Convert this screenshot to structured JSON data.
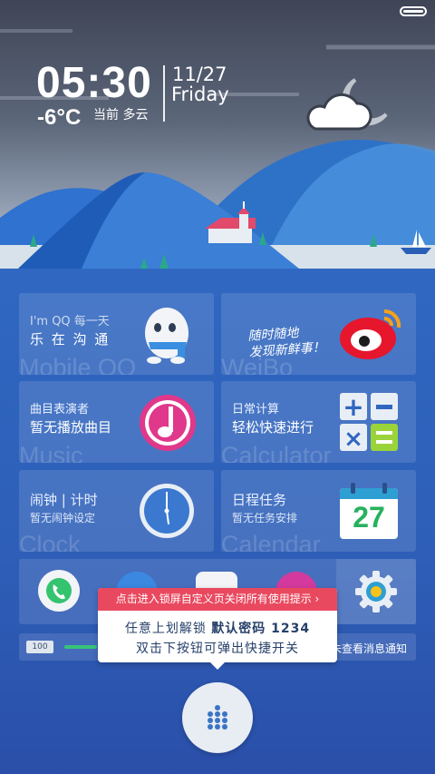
{
  "status": {
    "battery_icon": "battery-icon"
  },
  "clock": {
    "time": "05:30",
    "date": "11/27",
    "day": "Friday"
  },
  "weather": {
    "temp": "-6°C",
    "condition": "当前 多云",
    "icon": "cloud-moon-icon"
  },
  "tiles": [
    {
      "line1": "I'm QQ 每一天",
      "line2": "乐 在 沟 通",
      "ghost": "Mobile QQ",
      "icon": "qq-penguin-icon"
    },
    {
      "line1": "随时随地",
      "line2": "发现新鲜事！",
      "ghost": "WeiBo",
      "icon": "weibo-icon"
    },
    {
      "line1": "曲目表演者",
      "line2": "暂无播放曲目",
      "ghost": "Music",
      "icon": "music-note-icon"
    },
    {
      "line1": "日常计算",
      "line2": "轻松快速进行",
      "ghost": "Calculator",
      "icon": "calculator-icon"
    },
    {
      "line1": "闹钟 | 计时",
      "line2": "暂无闹钟设定",
      "ghost": "Clock",
      "icon": "clock-icon"
    },
    {
      "line1": "日程任务",
      "line2": "暂无任务安排",
      "ghost": "Calendar",
      "icon": "calendar-icon",
      "calendar_day": "27"
    }
  ],
  "dock": {
    "icons": [
      "phone-icon",
      "browser-icon",
      "camera-icon",
      "gallery-icon",
      "settings-gear-icon"
    ]
  },
  "tooltip": {
    "header": "点击进入锁屏自定义页关闭所有使用提示 ›",
    "line1_a": "任意上划解锁 ",
    "line1_b": "默认密码 1234",
    "line2": "双击下按钮可弹出快捷开关"
  },
  "message_bar": {
    "badge": "100",
    "text": "未查看消息通知"
  },
  "home_button": {
    "icon": "dots-grid-icon"
  },
  "colors": {
    "accent_red": "#e9495f",
    "green": "#38c37a",
    "weibo_red": "#e6162d",
    "music_pink": "#e0388b"
  }
}
